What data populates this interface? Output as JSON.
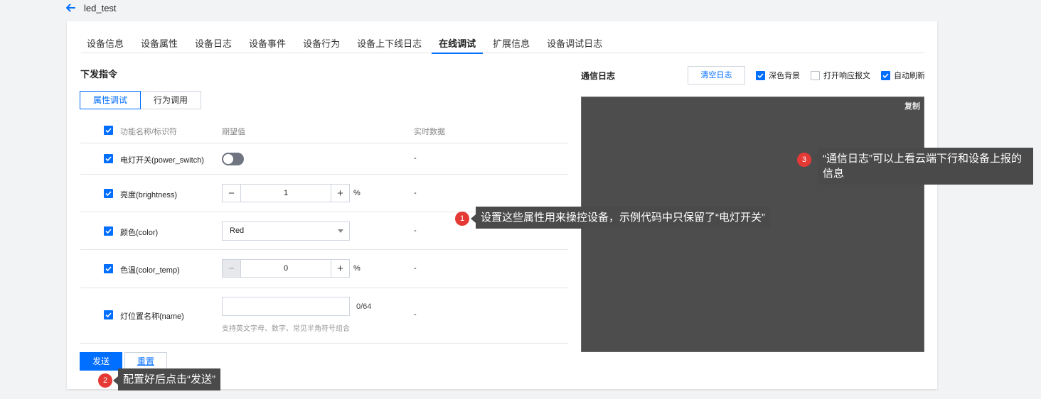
{
  "header": {
    "title": "led_test"
  },
  "tabs": [
    {
      "label": "设备信息"
    },
    {
      "label": "设备属性"
    },
    {
      "label": "设备日志"
    },
    {
      "label": "设备事件"
    },
    {
      "label": "设备行为"
    },
    {
      "label": "设备上下线日志"
    },
    {
      "label": "在线调试",
      "active": true
    },
    {
      "label": "扩展信息"
    },
    {
      "label": "设备调试日志"
    }
  ],
  "left": {
    "title": "下发指令",
    "modes": {
      "property": "属性调试",
      "action": "行为调用"
    },
    "table": {
      "headers": {
        "name": "功能名称/标识符",
        "expected": "期望值",
        "realtime": "实时数据"
      },
      "rows": [
        {
          "name": "电灯开关(power_switch)",
          "realtime": "-",
          "switch_on": false
        },
        {
          "name": "亮度(brightness)",
          "value": "1",
          "unit": "%",
          "realtime": "-"
        },
        {
          "name": "颜色(color)",
          "selected": "Red",
          "realtime": "-"
        },
        {
          "name": "色温(color_temp)",
          "value": "0",
          "unit": "%",
          "realtime": "-"
        },
        {
          "name": "灯位置名称(name)",
          "value": "",
          "counter": "0/64",
          "hint": "支持英文字母、数字、常见半角符号组合",
          "realtime": "-"
        }
      ]
    },
    "buttons": {
      "send": "发送",
      "reset": "重置"
    }
  },
  "right": {
    "title": "通信日志",
    "clear_label": "清空日志",
    "options": {
      "dark_bg": "深色背景",
      "open_response": "打开响应报文",
      "auto_refresh": "自动刷新"
    },
    "copy_label": "复制"
  },
  "callouts": {
    "c1": {
      "num": "1",
      "text": "设置这些属性用来操控设备，示例代码中只保留了“电灯开关”"
    },
    "c2": {
      "num": "2",
      "text": "配置好后点击“发送”"
    },
    "c3": {
      "num": "3",
      "text": "“通信日志”可以上看云端下行和设备上报的信息"
    }
  },
  "colors": {
    "accent": "#006eff",
    "console_bg": "#4d4d4d",
    "badge": "#e53935",
    "tooltip_bg": "#4a4a4a"
  }
}
